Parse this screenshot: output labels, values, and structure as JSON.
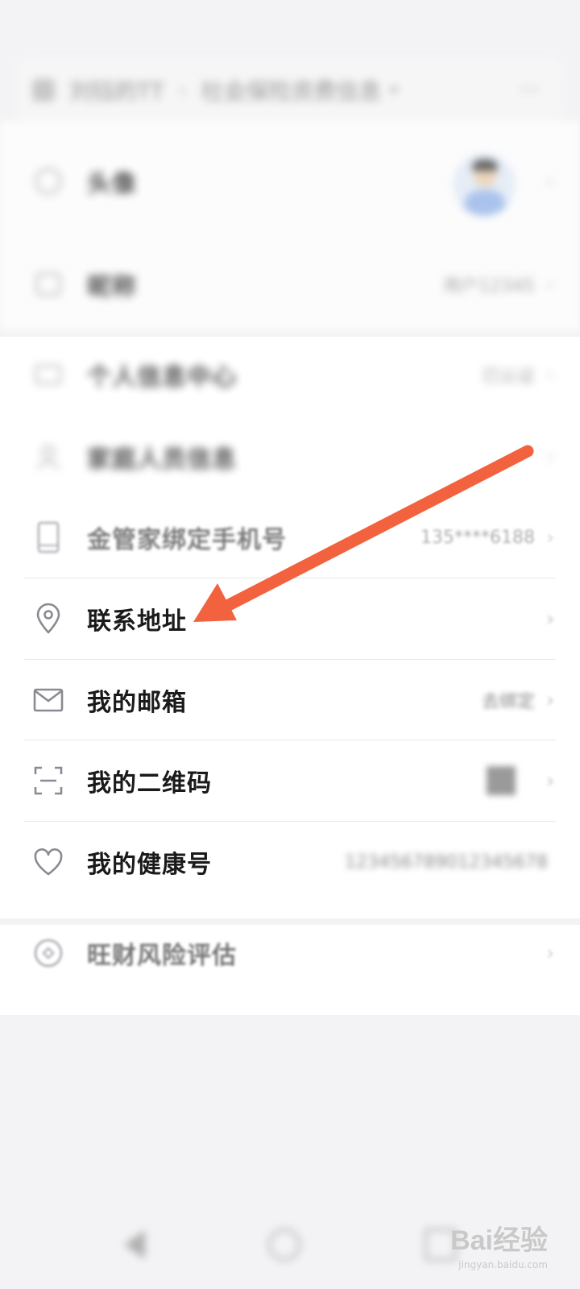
{
  "header": {
    "breadcrumb_first": "刘钰的TT",
    "breadcrumb_second": "社会保险资费信息",
    "more_label": "···"
  },
  "top_items": [
    {
      "id": "avatar",
      "label": "头像",
      "icon": "face-icon"
    },
    {
      "id": "nickname",
      "label": "昵称",
      "icon": "id-card-icon",
      "value": "用户12345"
    }
  ],
  "menu_items": [
    {
      "id": "personal-info",
      "label": "个人信息中心",
      "icon": "profile-card-icon",
      "value": "已认证"
    },
    {
      "id": "family",
      "label": "家庭人员信息",
      "icon": "person-icon",
      "value": ""
    },
    {
      "id": "phone-binding",
      "label": "金管家绑定手机号",
      "icon": "phone-icon",
      "value": "135****6188"
    },
    {
      "id": "contact-address",
      "label": "联系地址",
      "icon": "location-pin-icon",
      "value": ""
    },
    {
      "id": "my-email",
      "label": "我的邮箱",
      "icon": "mail-icon",
      "value": "去绑定"
    },
    {
      "id": "my-qrcode",
      "label": "我的二维码",
      "icon": "scan-icon",
      "value": ""
    },
    {
      "id": "my-health",
      "label": "我的健康号",
      "icon": "heart-icon",
      "value": "123456789012345678"
    }
  ],
  "bottom_items": [
    {
      "id": "risk",
      "label": "旺财风险评估",
      "icon": "target-icon",
      "value": ""
    }
  ],
  "annotation": {
    "color": "#f2623e"
  },
  "watermark": {
    "brand": "Bai经验",
    "url": "jingyan.baidu.com"
  },
  "colors": {
    "background": "#f3f3f5",
    "card": "#ffffff",
    "text": "#1a1a1a",
    "icon": "#8a8a94"
  }
}
